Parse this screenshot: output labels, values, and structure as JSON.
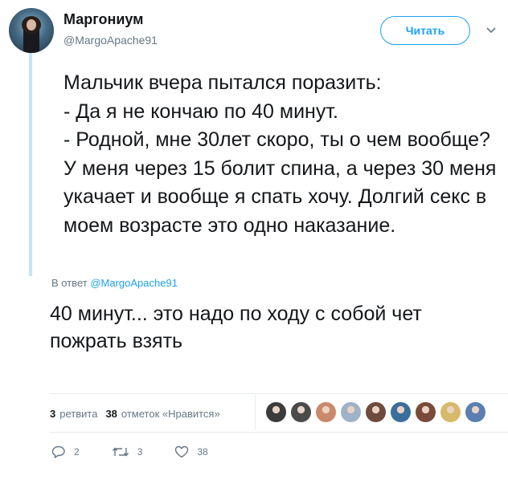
{
  "author": {
    "name": "Маргониум",
    "handle": "@MargoApache91"
  },
  "follow_button": {
    "label": "Читать"
  },
  "quoted_text": "Мальчик вчера пытался поразить:\n- Да я не кончаю по 40 минут.\n- Родной, мне 30лет скоро, ты о чем вообще? У меня через 15 болит спина, а через 30 меня укачает и вообще я спать хочу. Долгий секс в моем возрасте это одно наказание.",
  "reply": {
    "prefix": "В ответ",
    "to": "@MargoApache91"
  },
  "tweet_text": "40 минут... это надо по ходу с собой чет пожрать взять",
  "stats": {
    "retweets_count": "3",
    "retweets_label": "ретвита",
    "likes_count": "38",
    "likes_label": "отметок «Нравится»"
  },
  "liker_colors": [
    "#3b3b3b",
    "#4a4a4a",
    "#c98a6b",
    "#9fb3c8",
    "#6d4c3d",
    "#3a6f9c",
    "#7a4a3a",
    "#d8b86a",
    "#5a7fb0"
  ],
  "actions": {
    "replies": "2",
    "retweets": "3",
    "likes": "38"
  },
  "colors": {
    "accent": "#1da1f2",
    "muted": "#657786",
    "thread_line": "#c4e4f9"
  }
}
